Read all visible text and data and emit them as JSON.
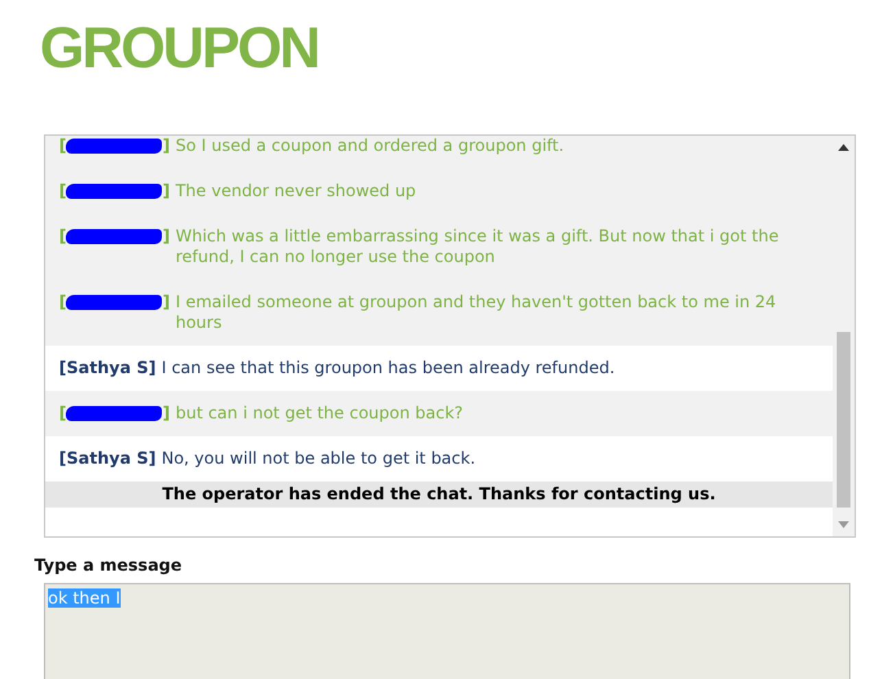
{
  "logo": "GROUPON",
  "chat": {
    "messages": [
      {
        "kind": "customer",
        "open": "[",
        "close": "]",
        "redacted": true,
        "text": "So I used a coupon and ordered a groupon gift."
      },
      {
        "kind": "customer",
        "open": "[",
        "close": "]",
        "redacted": true,
        "text": "The vendor never showed up"
      },
      {
        "kind": "customer",
        "open": "[",
        "close": "]",
        "redacted": true,
        "text": "Which was a little embarrassing since it was a gift. But now that i got the refund, I can no longer use the coupon"
      },
      {
        "kind": "customer",
        "open": "[",
        "close": "]",
        "redacted": true,
        "text": "I emailed someone at groupon and they haven't gotten back to me in 24 hours"
      },
      {
        "kind": "operator",
        "author": "[Sathya S]",
        "text": "I can see that this groupon has been already refunded."
      },
      {
        "kind": "customer",
        "open": "[",
        "close": "]",
        "redacted": true,
        "text": "but can i not get the coupon back?"
      },
      {
        "kind": "operator",
        "author": "[Sathya S]",
        "text": "No, you will not be able to get it back."
      },
      {
        "kind": "system",
        "text": "The operator has ended the chat. Thanks for contacting us."
      }
    ]
  },
  "composer": {
    "label": "Type a message",
    "value": "ok then I",
    "selected": true
  }
}
